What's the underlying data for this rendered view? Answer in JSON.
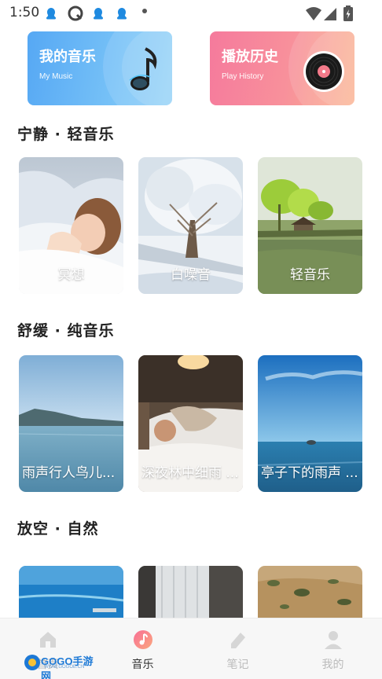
{
  "status": {
    "time": "1:50",
    "app_icons": [
      "qq-icon",
      "q-browser-icon",
      "qq-icon",
      "qq-icon"
    ]
  },
  "cards": {
    "music": {
      "title": "我的音乐",
      "subtitle": "My Music",
      "icon": "music-note-icon"
    },
    "history": {
      "title": "播放历史",
      "subtitle": "Play History",
      "icon": "vinyl-record-icon"
    }
  },
  "sections": [
    {
      "title": "宁静 · 轻音乐",
      "items": [
        {
          "label": "冥想",
          "image": "sleeping-girl"
        },
        {
          "label": "白噪音",
          "image": "frosted-tree"
        },
        {
          "label": "轻音乐",
          "image": "lake-pavilion"
        }
      ]
    },
    {
      "title": "舒缓 · 纯音乐",
      "items": [
        {
          "label": "雨声行人鸟儿...",
          "image": "lake-mountains"
        },
        {
          "label": "深夜林中细雨 ...",
          "image": "sleeping-man"
        },
        {
          "label": "亭子下的雨声 ...",
          "image": "ocean-horizon"
        }
      ]
    },
    {
      "title": "放空 · 自然",
      "items": [
        {
          "label": "",
          "image": "aerial-sea"
        },
        {
          "label": "",
          "image": "window-curtain"
        },
        {
          "label": "",
          "image": "savanna"
        }
      ]
    }
  ],
  "nav": {
    "items": [
      {
        "label": "首页",
        "icon": "home-icon",
        "active": false
      },
      {
        "label": "音乐",
        "icon": "music-icon",
        "active": true
      },
      {
        "label": "笔记",
        "icon": "note-icon",
        "active": false
      },
      {
        "label": "我的",
        "icon": "profile-icon",
        "active": false
      }
    ]
  },
  "watermark": {
    "brand": "GOGO手游网",
    "url": "WWW.GOGOE.CN"
  },
  "colors": {
    "music_card": "#6cb8f6",
    "history_card": "#f78da0",
    "active_nav": "#333333",
    "inactive_nav": "#bbbbbb"
  }
}
